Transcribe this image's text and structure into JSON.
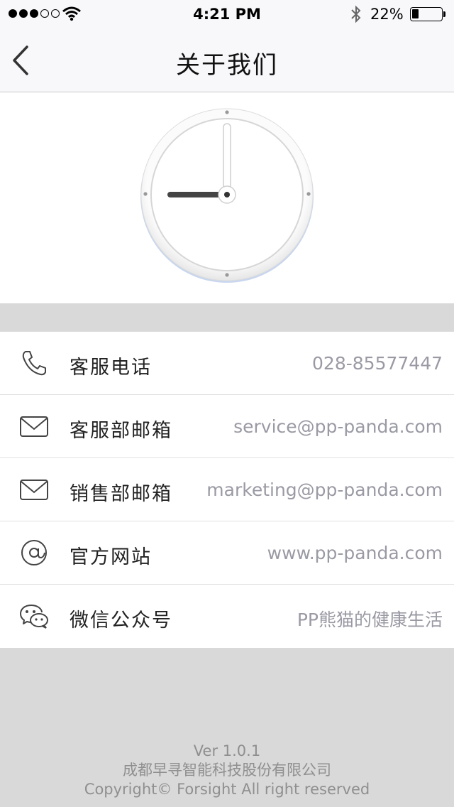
{
  "status_bar": {
    "time": "4:21 PM",
    "battery_percent": "22%",
    "signal_strength": 3,
    "battery_level": 0.22
  },
  "nav": {
    "title": "关于我们",
    "back_icon": "chevron-left-icon"
  },
  "clock": {
    "hour": 9,
    "minute": 0
  },
  "contacts": [
    {
      "icon": "phone-icon",
      "label": "客服电话",
      "value": "028-85577447"
    },
    {
      "icon": "mail-icon",
      "label": "客服部邮箱",
      "value": "service@pp-panda.com"
    },
    {
      "icon": "mail-icon",
      "label": "销售部邮箱",
      "value": "marketing@pp-panda.com"
    },
    {
      "icon": "at-icon",
      "label": "官方网站",
      "value": "www.pp-panda.com"
    },
    {
      "icon": "wechat-icon",
      "label": "微信公众号",
      "value": "PP熊猫的健康生活"
    }
  ],
  "footer": {
    "version": "Ver 1.0.1",
    "company": "成都早寻智能科技股份有限公司",
    "copyright": "Copyright© Forsight All right reserved"
  }
}
